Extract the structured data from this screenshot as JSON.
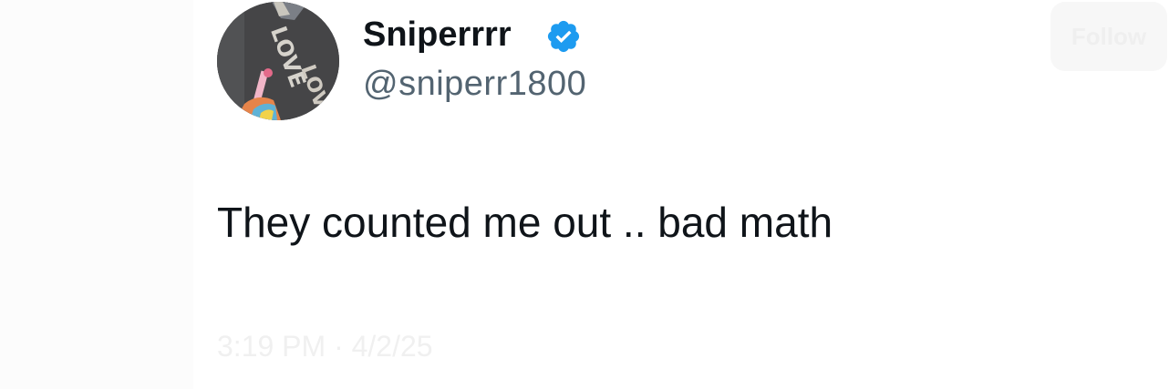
{
  "tweet": {
    "author": {
      "display_name": "Sniperrrr",
      "handle": "@sniperr1800",
      "verified": true,
      "avatar_icon": "avatar-photo-icon",
      "verified_icon": "verified-badge-icon"
    },
    "text": "They counted me out .. bad math",
    "timestamp": "3:19 PM · 4/2/25"
  },
  "header": {
    "faint_button_label": "Follow"
  },
  "colors": {
    "text_primary": "#0f1419",
    "text_secondary": "#536471",
    "verified_blue": "#1d9bf0",
    "background": "#ffffff"
  }
}
